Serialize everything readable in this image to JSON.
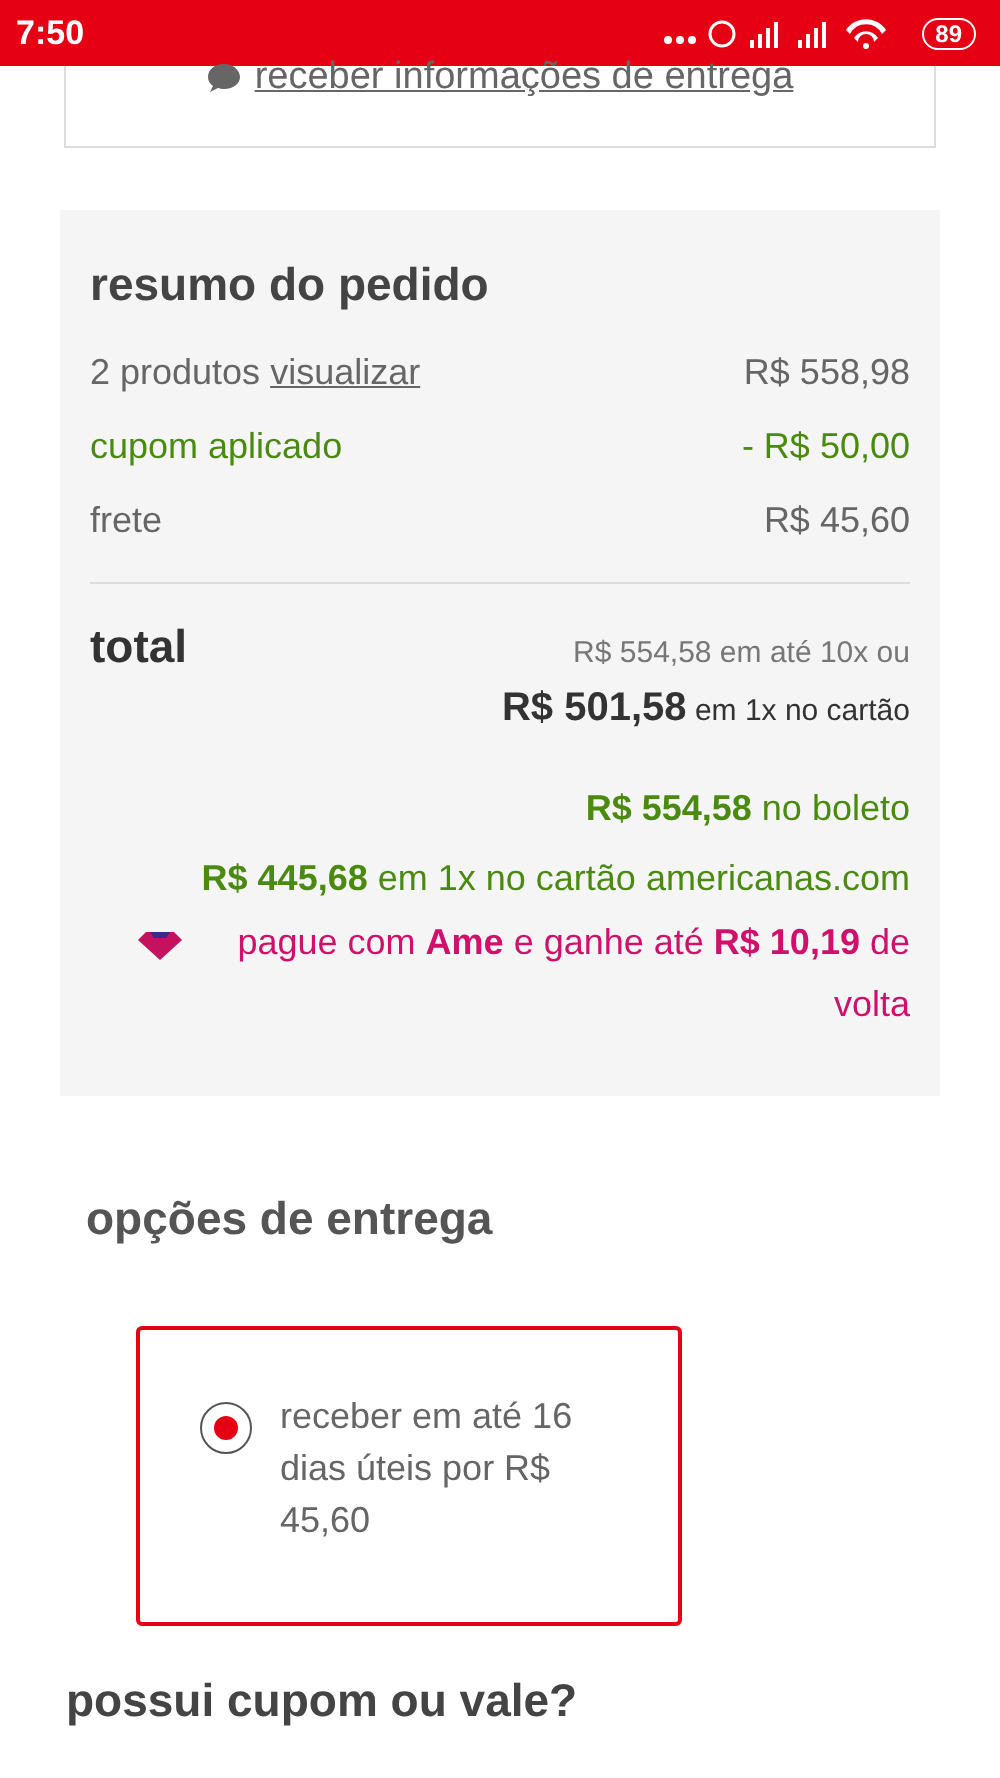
{
  "status_bar": {
    "time": "7:50",
    "battery": "89"
  },
  "delivery_info_link": {
    "text": "receber informações de entrega"
  },
  "order_summary": {
    "title": "resumo do pedido",
    "rows": [
      {
        "kind": "normal",
        "label": "2 produtos",
        "link": "visualizar",
        "value": "R$ 558,98"
      },
      {
        "kind": "discount",
        "label": "cupom aplicado",
        "value": "- R$ 50,00"
      },
      {
        "kind": "normal",
        "label": "frete",
        "value": "R$ 45,60"
      }
    ],
    "total": {
      "label": "total",
      "installments": "R$ 554,58 em até 10x ou",
      "card_price": "R$ 501,58",
      "card_suffix": "em 1x no cartão",
      "boleto_price": "R$ 554,58",
      "boleto_suffix": "no boleto",
      "store_card_price": "R$ 445,68",
      "store_card_suffix": "em 1x no cartão americanas.com",
      "ame_offer": "pague com **Ame** e ganhe até **R$ 10,19** de volta"
    }
  },
  "delivery": {
    "title": "opções de entrega",
    "options": [
      {
        "text": "receber em até 16 dias úteis por R$ 45,60",
        "selected": true
      }
    ]
  },
  "coupon": {
    "title": "possui cupom ou vale?"
  }
}
